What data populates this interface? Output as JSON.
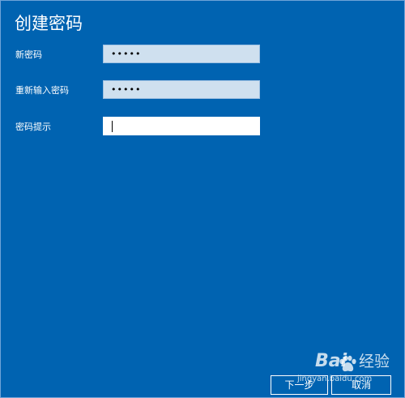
{
  "dialog": {
    "title": "创建密码"
  },
  "fields": {
    "new_password": {
      "label": "新密码",
      "value": "•••••"
    },
    "confirm_password": {
      "label": "重新输入密码",
      "value": "•••••"
    },
    "hint": {
      "label": "密码提示",
      "value": ""
    }
  },
  "buttons": {
    "next_label": "下一步",
    "cancel_label": "取消"
  },
  "watermark": {
    "logo_text": "Bai",
    "logo_text_2": "经验",
    "url": "jingyan.baidu.com"
  },
  "colors": {
    "background": "#0063b1",
    "field_background": "#cfe0ef",
    "focused_field_background": "#ffffff",
    "text": "#ffffff"
  }
}
